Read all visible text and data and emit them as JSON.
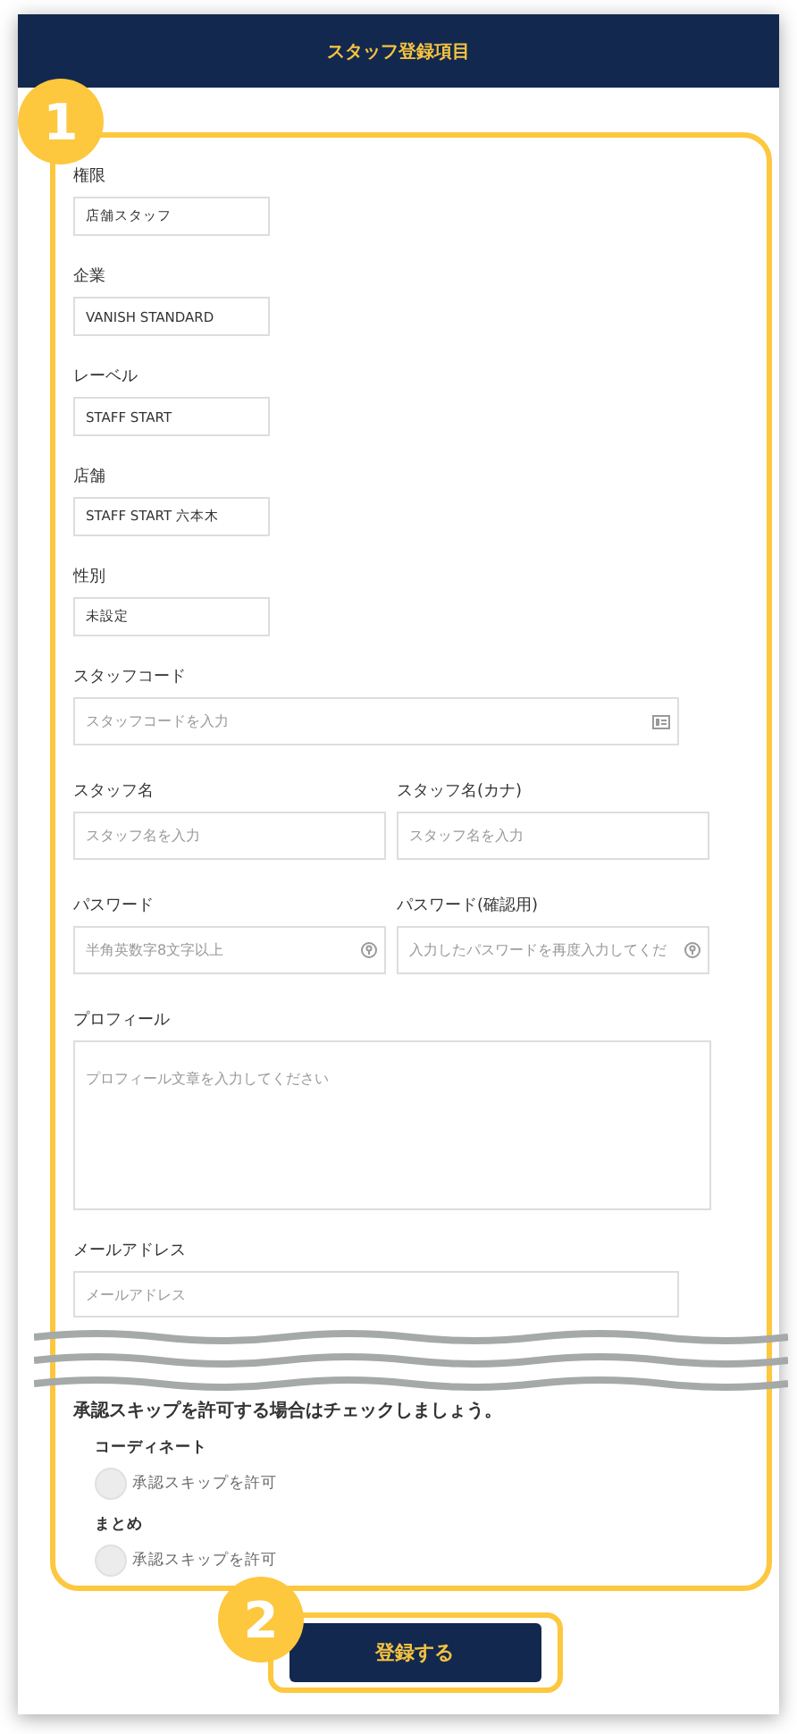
{
  "header": {
    "title": "スタッフ登録項目"
  },
  "form_callout": {
    "number": "1"
  },
  "readonly_fields": [
    {
      "label": "権限",
      "value": "店舗スタッフ"
    },
    {
      "label": "企業",
      "value": "VANISH STANDARD"
    },
    {
      "label": "レーベル",
      "value": "STAFF START"
    },
    {
      "label": "店舗",
      "value": "STAFF START 六本木"
    },
    {
      "label": "性別",
      "value": "未設定"
    }
  ],
  "input_rows": [
    {
      "fields": [
        {
          "label": "スタッフコード",
          "placeholder": "スタッフコードを入力",
          "kind": "code"
        }
      ]
    },
    {
      "fields": [
        {
          "label": "スタッフ名",
          "placeholder": "スタッフ名を入力",
          "kind": "text"
        },
        {
          "label": "スタッフ名(カナ)",
          "placeholder": "スタッフ名を入力",
          "kind": "text"
        }
      ]
    },
    {
      "fields": [
        {
          "label": "パスワード",
          "placeholder": "半角英数字8文字以上",
          "kind": "password"
        },
        {
          "label": "パスワード(確認用)",
          "placeholder": "入力したパスワードを再度入力してくだ",
          "kind": "password"
        }
      ]
    }
  ],
  "profile": {
    "label": "プロフィール",
    "placeholder": "プロフィール文章を入力してください"
  },
  "email": {
    "label": "メールアドレス",
    "placeholder": "メールアドレス"
  },
  "skip_approval": {
    "heading": "承認スキップを許可する場合はチェックしましょう。",
    "groups": [
      {
        "label": "コーディネート",
        "option": "承認スキップを許可",
        "checked": false
      },
      {
        "label": "まとめ",
        "option": "承認スキップを許可",
        "checked": false
      }
    ]
  },
  "submit_callout": {
    "number": "2"
  },
  "submit_button": {
    "label": "登録する"
  }
}
